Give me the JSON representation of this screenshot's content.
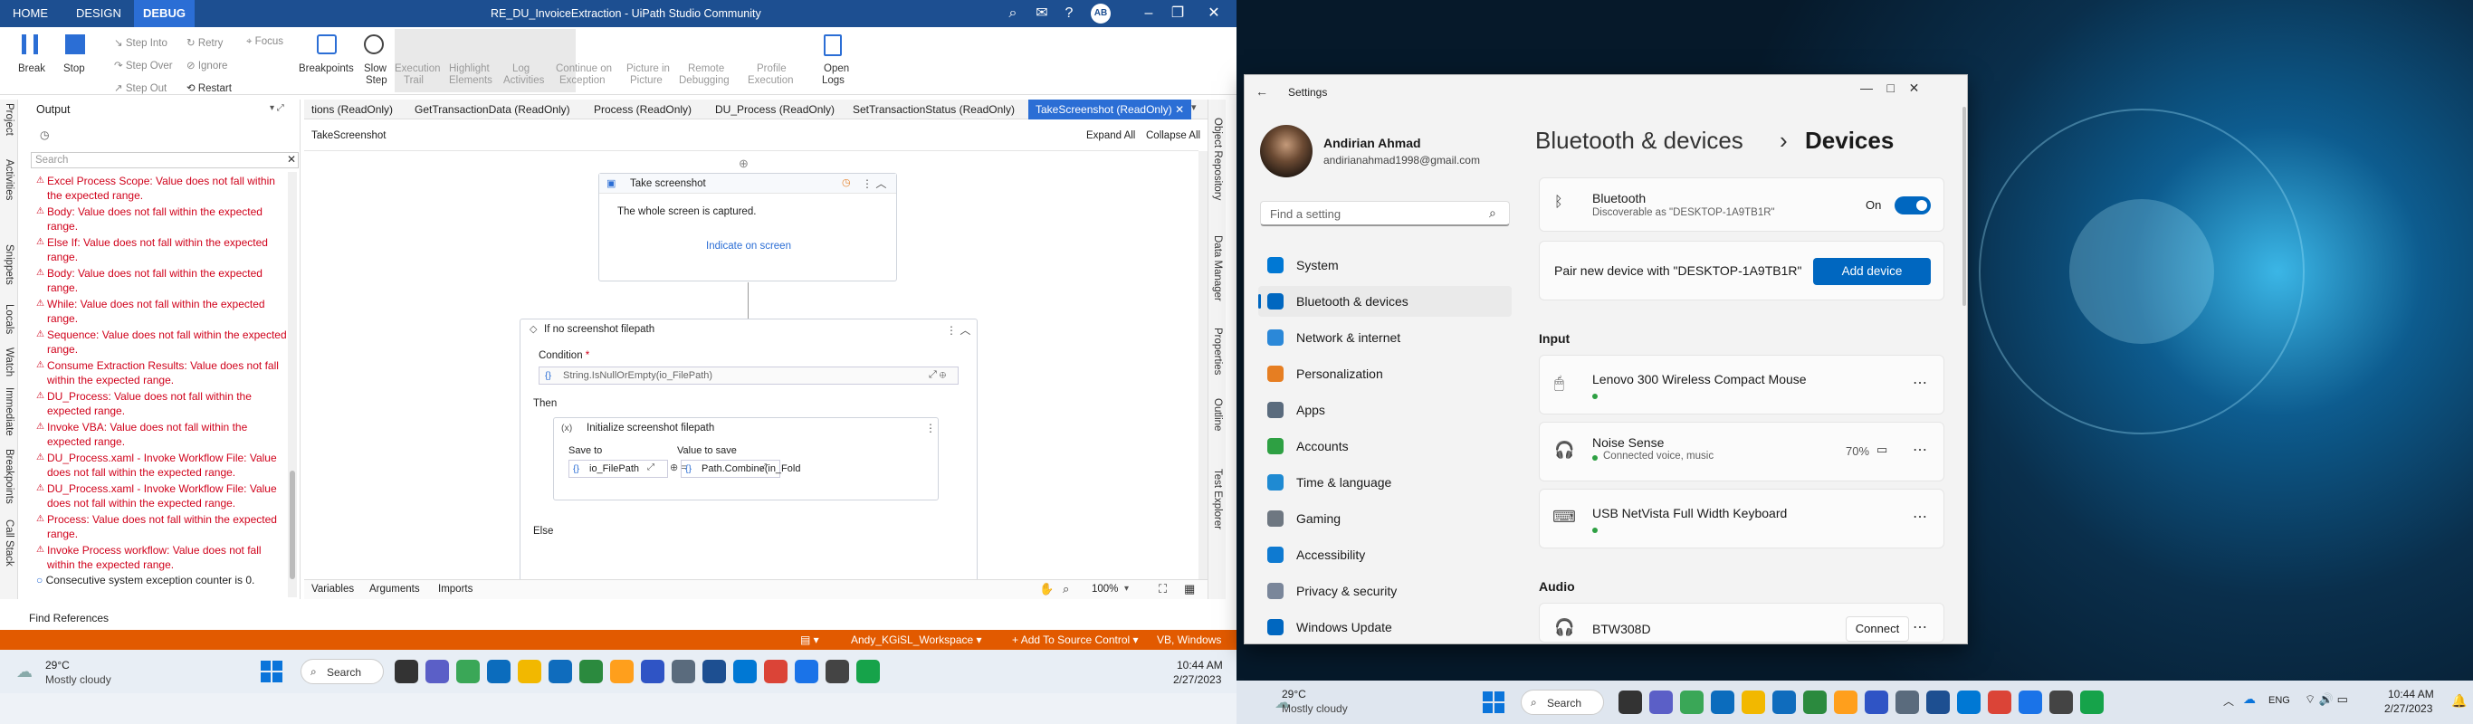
{
  "studio": {
    "tabs": [
      "HOME",
      "DESIGN",
      "DEBUG"
    ],
    "title": "RE_DU_InvoiceExtraction - UiPath Studio Community",
    "avatar": "AB",
    "ribbon": {
      "break": "Break",
      "stop": "Stop",
      "step_into": "Step Into",
      "step_over": "Step Over",
      "step_out": "Step Out",
      "retry": "Retry",
      "ignore": "Ignore",
      "restart": "Restart",
      "focus": "Focus",
      "breakpoints": "Breakpoints",
      "slow_step_1": "Slow",
      "slow_step_2": "Step",
      "exec_trail_1": "Execution",
      "exec_trail_2": "Trail",
      "highlight_1": "Highlight",
      "highlight_2": "Elements",
      "log_1": "Log",
      "log_2": "Activities",
      "continue_1": "Continue on",
      "continue_2": "Exception",
      "pip_1": "Picture in",
      "pip_2": "Picture",
      "remote_1": "Remote",
      "remote_2": "Debugging",
      "profile_1": "Profile",
      "profile_2": "Execution",
      "open_logs_1": "Open",
      "open_logs_2": "Logs"
    },
    "left_vtabs": [
      "Project",
      "Activities",
      "Snippets",
      "Locals",
      "Watch",
      "Immediate",
      "Breakpoints",
      "Call Stack"
    ],
    "output": {
      "title": "Output",
      "search_placeholder": "Search",
      "errors": [
        "Excel Process Scope: Value does not fall within the expected range.",
        "Body: Value does not fall within the expected range.",
        "Else If: Value does not fall within the expected range.",
        "Body: Value does not fall within the expected range.",
        "While: Value does not fall within the expected range.",
        "Sequence: Value does not fall within the expected range.",
        "Consume Extraction Results: Value does not fall within the expected range.",
        "DU_Process: Value does not fall within the expected range.",
        "Invoke VBA: Value does not fall within the expected range.",
        "DU_Process.xaml - Invoke Workflow File: Value does not fall within the expected range.",
        "DU_Process.xaml - Invoke Workflow File: Value does not fall within the expected range.",
        "Process: Value does not fall within the expected range.",
        "Invoke Process workflow: Value does not fall within the expected range."
      ],
      "info": "Consecutive system exception counter is 0.",
      "find_references": "Find References"
    },
    "doc_tabs": [
      "tions (ReadOnly)",
      "GetTransactionData (ReadOnly)",
      "Process (ReadOnly)",
      "DU_Process (ReadOnly)",
      "SetTransactionStatus (ReadOnly)",
      "TakeScreenshot (ReadOnly)"
    ],
    "breadcrumb": "TakeScreenshot",
    "expand_all": "Expand All",
    "collapse_all": "Collapse All",
    "take_screenshot": {
      "title": "Take screenshot",
      "desc": "The whole screen is captured.",
      "link": "Indicate on screen"
    },
    "if_block": {
      "title": "If no screenshot filepath",
      "condition_label": "Condition",
      "condition_value": "String.IsNullOrEmpty(io_FilePath)",
      "then": "Then",
      "else": "Else"
    },
    "assign": {
      "title": "Initialize screenshot filepath",
      "save_to_label": "Save to",
      "save_to_value": "io_FilePath",
      "value_label": "Value to save",
      "value_value": "Path.Combine(in_Fold"
    },
    "bottom_tabs": [
      "Variables",
      "Arguments",
      "Imports"
    ],
    "zoom": "100%",
    "right_vtabs": [
      "Object Repository",
      "Data Manager",
      "Properties",
      "Outline",
      "Test Explorer"
    ],
    "status": {
      "workspace": "Andy_KGiSL_Workspace",
      "source": "Add To Source Control",
      "version": "VB, Windows"
    },
    "taskbar": {
      "weather_temp": "29°C",
      "weather_desc": "Mostly cloudy",
      "search": "Search",
      "time": "10:44 AM",
      "date": "2/27/2023"
    }
  },
  "settings": {
    "window_title": "Settings",
    "user_name": "Andirian Ahmad",
    "user_email": "andirianahmad1998@gmail.com",
    "search_placeholder": "Find a setting",
    "nav": [
      {
        "label": "System",
        "color": "#0078d4"
      },
      {
        "label": "Bluetooth & devices",
        "color": "#0067c0"
      },
      {
        "label": "Network & internet",
        "color": "#2b88d8"
      },
      {
        "label": "Personalization",
        "color": "#e67e22"
      },
      {
        "label": "Apps",
        "color": "#5a6b7d"
      },
      {
        "label": "Accounts",
        "color": "#2ea043"
      },
      {
        "label": "Time & language",
        "color": "#1f8ad2"
      },
      {
        "label": "Gaming",
        "color": "#6e7781"
      },
      {
        "label": "Accessibility",
        "color": "#0e7ad1"
      },
      {
        "label": "Privacy & security",
        "color": "#7a869a"
      },
      {
        "label": "Windows Update",
        "color": "#0067c0"
      }
    ],
    "breadcrumb_parent": "Bluetooth & devices",
    "breadcrumb_current": "Devices",
    "bluetooth": {
      "title": "Bluetooth",
      "sub": "Discoverable as \"DESKTOP-1A9TB1R\"",
      "state": "On"
    },
    "pair": {
      "text": "Pair new device with \"DESKTOP-1A9TB1R\"",
      "button": "Add device"
    },
    "input_header": "Input",
    "devices": [
      {
        "name": "Lenovo 300 Wireless Compact Mouse",
        "sub": ""
      },
      {
        "name": "Noise Sense",
        "sub": "Connected voice, music",
        "battery": "70%"
      },
      {
        "name": "USB NetVista Full Width Keyboard",
        "sub": ""
      }
    ],
    "audio_header": "Audio",
    "audio_device": {
      "name": "BTW308D",
      "button": "Connect"
    },
    "taskbar": {
      "weather_temp": "29°C",
      "weather_desc": "Mostly cloudy",
      "search": "Search",
      "lang": "ENG",
      "time": "10:44 AM",
      "date": "2/27/2023"
    },
    "accent": "#0067c0"
  }
}
